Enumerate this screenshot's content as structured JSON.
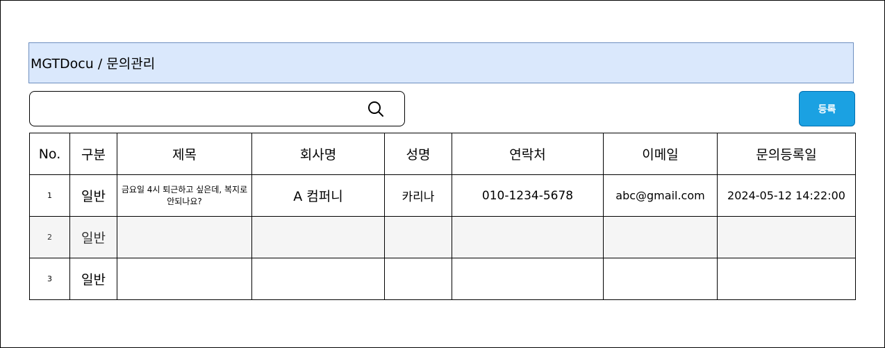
{
  "breadcrumb": "MGTDocu / 문의관리",
  "search": {
    "value": "",
    "placeholder": "",
    "icon": "search-icon"
  },
  "register_button": {
    "label": "등록",
    "color": "#1ba1e2"
  },
  "colors": {
    "breadcrumb_bg": "#dae8fc",
    "breadcrumb_border": "#6c8ebf",
    "alt_row_bg": "#f5f5f5"
  },
  "table": {
    "columns": [
      "No.",
      "구분",
      "제목",
      "회사명",
      "성명",
      "연락처",
      "이메일",
      "문의등록일"
    ],
    "rows": [
      {
        "no": "1",
        "category": "일반",
        "title": "금요일 4시 퇴근하고 싶은데, 복지로 안되나요?",
        "company": "A 컴퍼니",
        "name": "카리나",
        "phone": "010-1234-5678",
        "email": "abc@gmail.com",
        "date": "2024-05-12 14:22:00"
      },
      {
        "no": "2",
        "category": "일반",
        "title": "",
        "company": "",
        "name": "",
        "phone": "",
        "email": "",
        "date": ""
      },
      {
        "no": "3",
        "category": "일반",
        "title": "",
        "company": "",
        "name": "",
        "phone": "",
        "email": "",
        "date": ""
      }
    ]
  }
}
